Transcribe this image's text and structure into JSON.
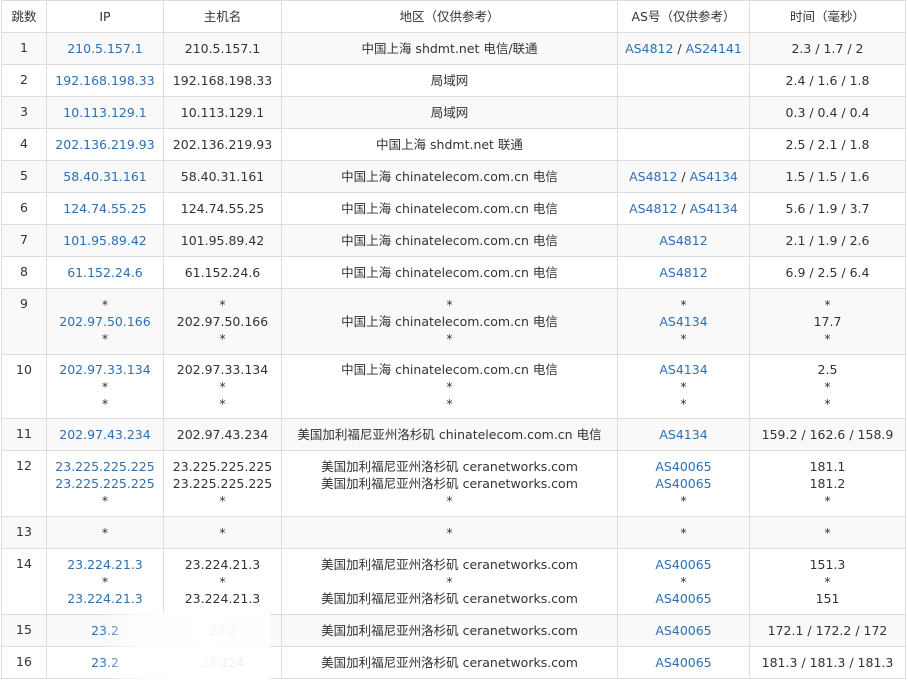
{
  "headers": {
    "hop": "跳数",
    "ip": "IP",
    "host": "主机名",
    "region": "地区（仅供参考）",
    "as": "AS号（仅供参考）",
    "time": "时间（毫秒）"
  },
  "rows": [
    {
      "hop": "1",
      "ip": [
        "210.5.157.1"
      ],
      "host": [
        "210.5.157.1"
      ],
      "region": [
        "中国上海 shdmt.net 电信/联通"
      ],
      "as": [
        [
          "AS4812",
          "AS24141"
        ]
      ],
      "time": [
        "2.3 / 1.7 / 2"
      ]
    },
    {
      "hop": "2",
      "ip": [
        "192.168.198.33"
      ],
      "host": [
        "192.168.198.33"
      ],
      "region": [
        "局域网"
      ],
      "as": [
        []
      ],
      "time": [
        "2.4 / 1.6 / 1.8"
      ]
    },
    {
      "hop": "3",
      "ip": [
        "10.113.129.1"
      ],
      "host": [
        "10.113.129.1"
      ],
      "region": [
        "局域网"
      ],
      "as": [
        []
      ],
      "time": [
        "0.3 / 0.4 / 0.4"
      ]
    },
    {
      "hop": "4",
      "ip": [
        "202.136.219.93"
      ],
      "host": [
        "202.136.219.93"
      ],
      "region": [
        "中国上海 shdmt.net 联通"
      ],
      "as": [
        []
      ],
      "time": [
        "2.5 / 2.1 / 1.8"
      ]
    },
    {
      "hop": "5",
      "ip": [
        "58.40.31.161"
      ],
      "host": [
        "58.40.31.161"
      ],
      "region": [
        "中国上海 chinatelecom.com.cn 电信"
      ],
      "as": [
        [
          "AS4812",
          "AS4134"
        ]
      ],
      "time": [
        "1.5 / 1.5 / 1.6"
      ]
    },
    {
      "hop": "6",
      "ip": [
        "124.74.55.25"
      ],
      "host": [
        "124.74.55.25"
      ],
      "region": [
        "中国上海 chinatelecom.com.cn 电信"
      ],
      "as": [
        [
          "AS4812",
          "AS4134"
        ]
      ],
      "time": [
        "5.6 / 1.9 / 3.7"
      ]
    },
    {
      "hop": "7",
      "ip": [
        "101.95.89.42"
      ],
      "host": [
        "101.95.89.42"
      ],
      "region": [
        "中国上海 chinatelecom.com.cn 电信"
      ],
      "as": [
        [
          "AS4812"
        ]
      ],
      "time": [
        "2.1 / 1.9 / 2.6"
      ]
    },
    {
      "hop": "8",
      "ip": [
        "61.152.24.6"
      ],
      "host": [
        "61.152.24.6"
      ],
      "region": [
        "中国上海 chinatelecom.com.cn 电信"
      ],
      "as": [
        [
          "AS4812"
        ]
      ],
      "time": [
        "6.9 / 2.5 / 6.4"
      ]
    },
    {
      "hop": "9",
      "ip": [
        "*",
        "202.97.50.166",
        "*"
      ],
      "host": [
        "*",
        "202.97.50.166",
        "*"
      ],
      "region": [
        "*",
        "中国上海 chinatelecom.com.cn 电信",
        "*"
      ],
      "as": [
        [
          "*"
        ],
        [
          "AS4134"
        ],
        [
          "*"
        ]
      ],
      "time": [
        "*",
        "17.7",
        "*"
      ]
    },
    {
      "hop": "10",
      "ip": [
        "202.97.33.134",
        "*",
        "*"
      ],
      "host": [
        "202.97.33.134",
        "*",
        "*"
      ],
      "region": [
        "中国上海 chinatelecom.com.cn 电信",
        "*",
        "*"
      ],
      "as": [
        [
          "AS4134"
        ],
        [
          "*"
        ],
        [
          "*"
        ]
      ],
      "time": [
        "2.5",
        "*",
        "*"
      ]
    },
    {
      "hop": "11",
      "ip": [
        "202.97.43.234"
      ],
      "host": [
        "202.97.43.234"
      ],
      "region": [
        "美国加利福尼亚州洛杉矶 chinatelecom.com.cn 电信"
      ],
      "as": [
        [
          "AS4134"
        ]
      ],
      "time": [
        "159.2 / 162.6 / 158.9"
      ]
    },
    {
      "hop": "12",
      "ip": [
        "23.225.225.225",
        "23.225.225.225",
        "*"
      ],
      "host": [
        "23.225.225.225",
        "23.225.225.225",
        "*"
      ],
      "region": [
        "美国加利福尼亚州洛杉矶 ceranetworks.com",
        "美国加利福尼亚州洛杉矶 ceranetworks.com",
        "*"
      ],
      "as": [
        [
          "AS40065"
        ],
        [
          "AS40065"
        ],
        [
          "*"
        ]
      ],
      "time": [
        "181.1",
        "181.2",
        "*"
      ]
    },
    {
      "hop": "13",
      "ip": [
        "*"
      ],
      "host": [
        "*"
      ],
      "region": [
        "*"
      ],
      "as": [
        [
          "*"
        ]
      ],
      "time": [
        "*"
      ]
    },
    {
      "hop": "14",
      "ip": [
        "23.224.21.3",
        "*",
        "23.224.21.3"
      ],
      "host": [
        "23.224.21.3",
        "*",
        "23.224.21.3"
      ],
      "region": [
        "美国加利福尼亚州洛杉矶 ceranetworks.com",
        "*",
        "美国加利福尼亚州洛杉矶 ceranetworks.com"
      ],
      "as": [
        [
          "AS40065"
        ],
        [
          "*"
        ],
        [
          "AS40065"
        ]
      ],
      "time": [
        "151.3",
        "*",
        "151"
      ]
    },
    {
      "hop": "15",
      "ip": [
        "23.2"
      ],
      "host": [
        "23.2"
      ],
      "region": [
        "美国加利福尼亚州洛杉矶 ceranetworks.com"
      ],
      "as": [
        [
          "AS40065"
        ]
      ],
      "time": [
        "172.1 / 172.2 / 172"
      ]
    },
    {
      "hop": "16",
      "ip": [
        "23.2"
      ],
      "host": [
        "23.224"
      ],
      "region": [
        "美国加利福尼亚州洛杉矶 ceranetworks.com"
      ],
      "as": [
        [
          "AS40065"
        ]
      ],
      "time": [
        "181.3 / 181.3 / 181.3"
      ]
    }
  ],
  "colors": {
    "link": "#2f6fb0",
    "border": "#dddddd",
    "stripe": "#f9f9f9",
    "text": "#333333"
  }
}
